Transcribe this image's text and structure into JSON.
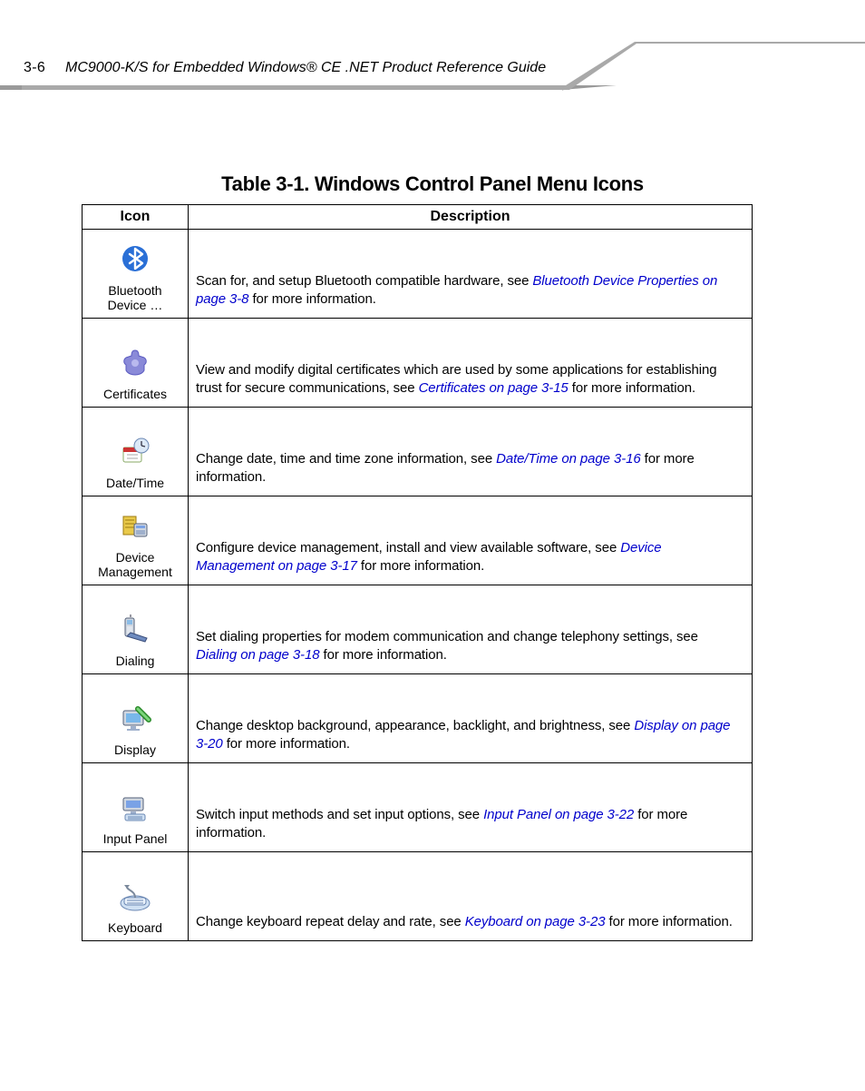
{
  "header": {
    "page_number": "3-6",
    "guide_title": "MC9000-K/S for Embedded Windows® CE .NET Product Reference Guide"
  },
  "table_title": "Table 3-1. Windows Control Panel Menu Icons",
  "columns": {
    "icon": "Icon",
    "desc": "Description"
  },
  "rows": [
    {
      "icon_name": "bluetooth-icon",
      "icon_label": "Bluetooth\nDevice …",
      "desc_pre": "Scan for, and setup Bluetooth compatible hardware, see ",
      "desc_link": "Bluetooth Device Properties on page 3-8",
      "desc_post": " for more information."
    },
    {
      "icon_name": "certificates-icon",
      "icon_label": "Certificates",
      "desc_pre": "View and modify digital certificates which are used by some applications for establishing trust for secure communications, see ",
      "desc_link": "Certificates on page 3-15",
      "desc_post": " for more information."
    },
    {
      "icon_name": "datetime-icon",
      "icon_label": "Date/Time",
      "desc_pre": "Change date, time and time zone information, see ",
      "desc_link": "Date/Time on page 3-16",
      "desc_post": " for more information."
    },
    {
      "icon_name": "device-management-icon",
      "icon_label": "Device\nManagement",
      "desc_pre": "Configure device management, install and view available software, see ",
      "desc_link": "Device Management on page 3-17",
      "desc_post": " for more information."
    },
    {
      "icon_name": "dialing-icon",
      "icon_label": "Dialing",
      "desc_pre": "Set dialing properties for modem communication and change telephony settings, see ",
      "desc_link": "Dialing on page 3-18",
      "desc_post": " for more information."
    },
    {
      "icon_name": "display-icon",
      "icon_label": "Display",
      "desc_pre": "Change desktop background, appearance, backlight, and brightness, see ",
      "desc_link": "Display on page 3-20",
      "desc_post": " for more information."
    },
    {
      "icon_name": "input-panel-icon",
      "icon_label": "Input Panel",
      "desc_pre": "Switch input methods and set input options, see ",
      "desc_link": "Input Panel on page 3-22",
      "desc_post": " for more information."
    },
    {
      "icon_name": "keyboard-icon",
      "icon_label": "Keyboard",
      "desc_pre": "Change keyboard repeat delay and rate, see ",
      "desc_link": "Keyboard on page 3-23",
      "desc_post": " for more information."
    }
  ]
}
